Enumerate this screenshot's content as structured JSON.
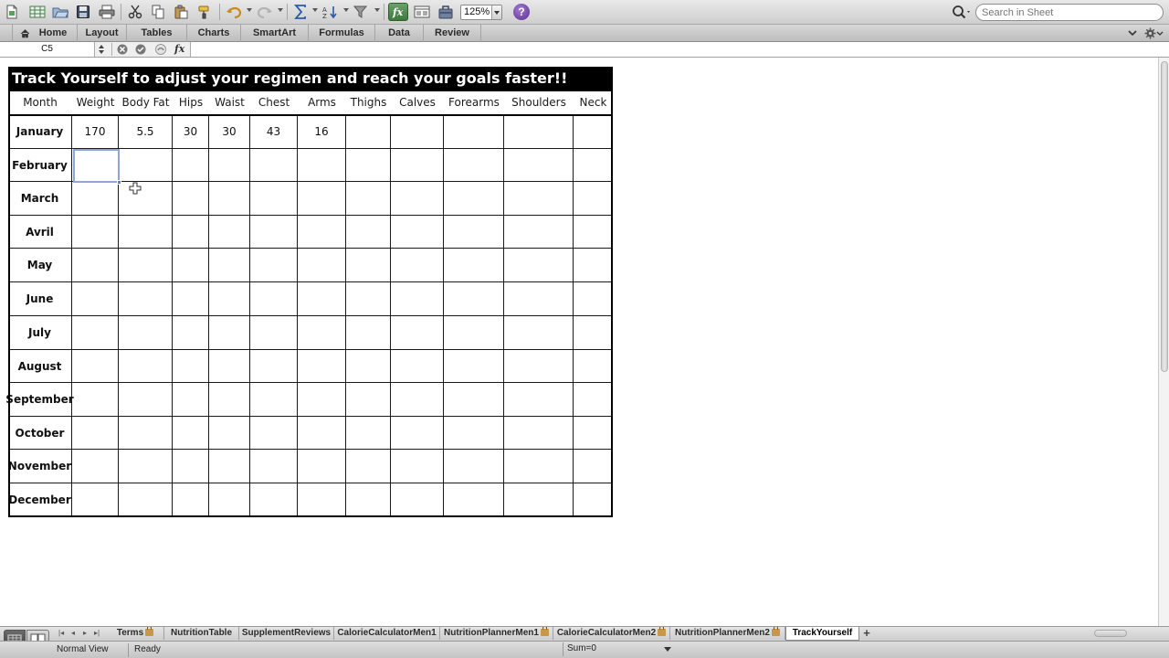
{
  "toolbar": {
    "zoom": "125%",
    "help_label": "?",
    "search_placeholder": "Search in Sheet",
    "icons": [
      "new-icon",
      "gallery-icon",
      "open-icon",
      "save-icon",
      "print-icon",
      "cut-icon",
      "copy-icon",
      "paste-icon",
      "format-painter-icon",
      "undo-icon",
      "redo-icon",
      "autosum-icon",
      "sort-icon",
      "filter-icon",
      "formula-builder-icon",
      "gallery-toggle-icon",
      "toolbox-icon",
      "search-icon"
    ]
  },
  "ribbon": {
    "tabs": [
      "Home",
      "Layout",
      "Tables",
      "Charts",
      "SmartArt",
      "Formulas",
      "Data",
      "Review"
    ]
  },
  "formula_bar": {
    "name_box": "C5",
    "fx": "fx",
    "value": ""
  },
  "sheet": {
    "title": "Track Yourself to adjust your regimen and reach your goals faster!!",
    "columns": [
      "Month",
      "Weight",
      "Body Fat",
      "Hips",
      "Waist",
      "Chest",
      "Arms",
      "Thighs",
      "Calves",
      "Forearms",
      "Shoulders",
      "Neck"
    ],
    "rows": [
      [
        "January",
        "170",
        "5.5",
        "30",
        "30",
        "43",
        "16",
        "",
        "",
        "",
        "",
        ""
      ],
      [
        "February",
        "",
        "",
        "",
        "",
        "",
        "",
        "",
        "",
        "",
        "",
        ""
      ],
      [
        "March",
        "",
        "",
        "",
        "",
        "",
        "",
        "",
        "",
        "",
        "",
        ""
      ],
      [
        "Avril",
        "",
        "",
        "",
        "",
        "",
        "",
        "",
        "",
        "",
        "",
        ""
      ],
      [
        "May",
        "",
        "",
        "",
        "",
        "",
        "",
        "",
        "",
        "",
        "",
        ""
      ],
      [
        "June",
        "",
        "",
        "",
        "",
        "",
        "",
        "",
        "",
        "",
        "",
        ""
      ],
      [
        "July",
        "",
        "",
        "",
        "",
        "",
        "",
        "",
        "",
        "",
        "",
        ""
      ],
      [
        "August",
        "",
        "",
        "",
        "",
        "",
        "",
        "",
        "",
        "",
        "",
        ""
      ],
      [
        "September",
        "",
        "",
        "",
        "",
        "",
        "",
        "",
        "",
        "",
        "",
        ""
      ],
      [
        "October",
        "",
        "",
        "",
        "",
        "",
        "",
        "",
        "",
        "",
        "",
        ""
      ],
      [
        "November",
        "",
        "",
        "",
        "",
        "",
        "",
        "",
        "",
        "",
        "",
        ""
      ],
      [
        "December",
        "",
        "",
        "",
        "",
        "",
        "",
        "",
        "",
        "",
        "",
        ""
      ]
    ],
    "selected": {
      "row": 1,
      "col": 1
    }
  },
  "sheet_tabs": {
    "nav": [
      "|◂",
      "◂",
      "▸",
      "▸|"
    ],
    "tabs": [
      {
        "label": "Terms",
        "locked": true,
        "active": false
      },
      {
        "label": "NutritionTable",
        "locked": false,
        "active": false
      },
      {
        "label": "SupplementReviews",
        "locked": false,
        "active": false
      },
      {
        "label": "CalorieCalculatorMen1",
        "locked": false,
        "active": false
      },
      {
        "label": "NutritionPlannerMen1",
        "locked": true,
        "active": false
      },
      {
        "label": "CalorieCalculatorMen2",
        "locked": true,
        "active": false
      },
      {
        "label": "NutritionPlannerMen2",
        "locked": true,
        "active": false
      },
      {
        "label": "TrackYourself",
        "locked": false,
        "active": true
      }
    ],
    "add_label": "+"
  },
  "status": {
    "view": "Normal View",
    "ready": "Ready",
    "sum": "Sum=0"
  },
  "colors": {
    "banner_bg": "#000000",
    "banner_text": "#ffffff",
    "selection": "#8da6d7",
    "help": "#6b3aa3"
  }
}
